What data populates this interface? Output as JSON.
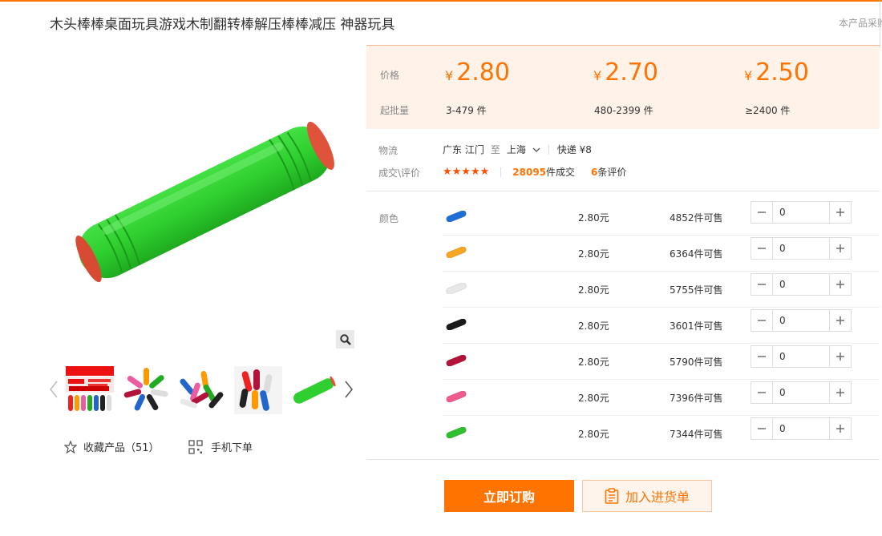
{
  "product": {
    "title": "木头棒棒桌面玩具游戏木制翻转棒解压棒棒减压 神器玩具",
    "side_note": "本产品采购"
  },
  "gallery": {
    "main_image": "green-wooden-stick",
    "thumbnails": [
      "seven-colors-poster",
      "sticks-radial",
      "sticks-pile",
      "sticks-colored",
      "green-stick"
    ],
    "favorite_label": "收藏产品（51）",
    "mobile_order_label": "手机下单"
  },
  "pricing": {
    "price_label": "价格",
    "moq_label": "起批量",
    "currency": "¥",
    "tiers": [
      {
        "price": "2.80",
        "range": "3-479 件"
      },
      {
        "price": "2.70",
        "range": "480-2399 件"
      },
      {
        "price": "2.50",
        "range": "≥2400 件"
      }
    ]
  },
  "logistics": {
    "label": "物流",
    "from": "广东 江门",
    "to_word": "至",
    "to": "上海",
    "delivery": "快递 ¥8"
  },
  "deals": {
    "label": "成交\\评价",
    "stars": "★★★★★",
    "deal_count": "28095",
    "deal_suffix": "件成交",
    "review_count": "6",
    "review_suffix": "条评价"
  },
  "sku": {
    "label": "颜色",
    "rows": [
      {
        "color": "#1f6fd6",
        "price": "2.80元",
        "stock": "4852件可售",
        "qty": "0"
      },
      {
        "color": "#f5a623",
        "price": "2.80元",
        "stock": "6364件可售",
        "qty": "0"
      },
      {
        "color": "#e8e8e8",
        "price": "2.80元",
        "stock": "5755件可售",
        "qty": "0"
      },
      {
        "color": "#1a1a1a",
        "price": "2.80元",
        "stock": "3601件可售",
        "qty": "0"
      },
      {
        "color": "#b3123a",
        "price": "2.80元",
        "stock": "5790件可售",
        "qty": "0"
      },
      {
        "color": "#ef5b8c",
        "price": "2.80元",
        "stock": "7396件可售",
        "qty": "0"
      },
      {
        "color": "#2fbf2f",
        "price": "2.80元",
        "stock": "7344件可售",
        "qty": "0"
      }
    ]
  },
  "actions": {
    "buy_now": "立即订购",
    "add_to_list": "加入进货单"
  },
  "colors": {
    "accent": "#ff7300",
    "price_bg": "#fff2e8"
  }
}
